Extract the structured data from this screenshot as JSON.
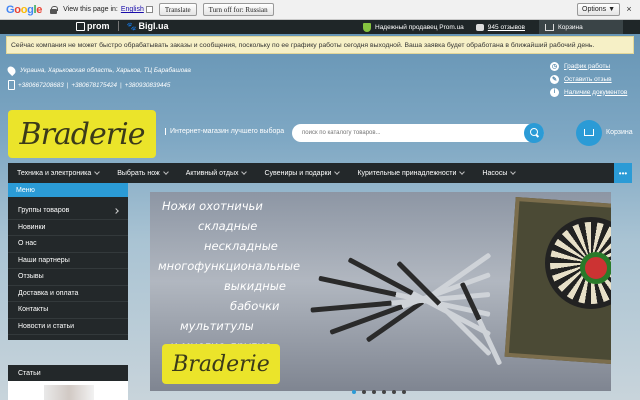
{
  "translate_bar": {
    "logo": [
      "G",
      "o",
      "o",
      "g",
      "l",
      "e"
    ],
    "view_text": "View this page in:",
    "language": "English",
    "translate_button": "Translate",
    "turn_off_button": "Turn off for: Russian",
    "options_button": "Options ▼",
    "close": "×"
  },
  "prom_bar": {
    "prom_logo": "prom",
    "bigl_logo": "Bigl.ua",
    "reliable_seller": "Надежный продавец Prom.ua",
    "reviews": "945 отзывов",
    "cart": "Корзина"
  },
  "notice": "Сейчас компания не может быстро обрабатывать заказы и сообщения, поскольку по ее графику работы сегодня выходной. Ваша заявка будет обработана в ближайший рабочий день.",
  "address": "Украина, Харьковская область, Харьков, ТЦ Барабашова",
  "phones": [
    "+380667208683",
    "+380678175424",
    "+380930839445"
  ],
  "right_links": {
    "schedule": "График работы",
    "review": "Оставить отзыв",
    "documents": "Наличие документов"
  },
  "brand": {
    "logo_text": "Braderie",
    "tagline": "Интернет-магазин лучшего выбора"
  },
  "search": {
    "placeholder": "поиск по каталогу товаров..."
  },
  "cart_label": "Корзина",
  "nav": {
    "items": [
      "Техника и электроника",
      "Выбрать нож",
      "Активный отдых",
      "Сувениры и подарки",
      "Курительные принадлежности",
      "Насосы"
    ],
    "more": "•••"
  },
  "sidebar": {
    "header": "Меню",
    "items": [
      "Группы товаров",
      "Новинки",
      "О нас",
      "Наши партнеры",
      "Отзывы",
      "Доставка и оплата",
      "Контакты",
      "Новости и статьи"
    ],
    "articles_header": "Статьи"
  },
  "banner": {
    "lines": [
      "Ножи охотничьи",
      "складные",
      "нескладные",
      "многофункциональные",
      "выкидные",
      "бабочки",
      "мультитулы",
      "и многие другие."
    ],
    "logo_text": "Braderie"
  },
  "colors": {
    "accent": "#2b9bd6",
    "dark": "#23282a",
    "logo_yellow": "#ebe42a",
    "notice_bg": "#f6f0c6"
  }
}
